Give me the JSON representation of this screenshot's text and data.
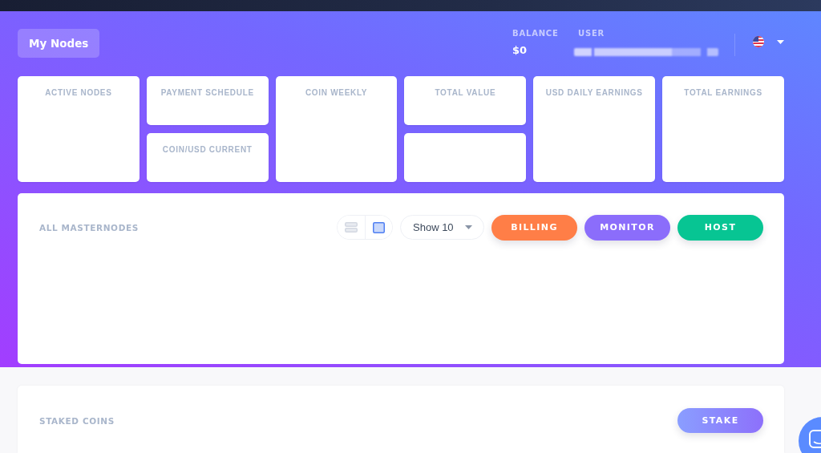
{
  "header": {
    "page_button": "My Nodes",
    "balance": {
      "label": "BALANCE",
      "value": "$0"
    },
    "user": {
      "label": "USER",
      "value_blurred": true
    }
  },
  "stat_columns": [
    {
      "cards": [
        {
          "kind": "titled",
          "title": "ACTIVE NODES"
        }
      ]
    },
    {
      "cards": [
        {
          "kind": "titled",
          "title": "PAYMENT SCHEDULE"
        },
        {
          "kind": "titled",
          "title": "COIN/USD CURRENT"
        }
      ]
    },
    {
      "cards": [
        {
          "kind": "titled",
          "title": "COIN WEEKLY"
        }
      ]
    },
    {
      "cards": [
        {
          "kind": "titled",
          "title": "TOTAL VALUE"
        },
        {
          "kind": "blank"
        }
      ]
    },
    {
      "cards": [
        {
          "kind": "titled",
          "title": "USD DAILY EARNINGS"
        }
      ]
    },
    {
      "cards": [
        {
          "kind": "titled",
          "title": "TOTAL EARNINGS"
        }
      ]
    }
  ],
  "masternodes": {
    "title": "ALL MASTERNODES",
    "view_toggle": [
      {
        "kind": "list",
        "selected": false
      },
      {
        "kind": "grid",
        "selected": true
      }
    ],
    "page_size": {
      "value": "Show 10"
    },
    "buttons": [
      {
        "label": "BILLING",
        "color": "#ff7e47"
      },
      {
        "label": "MONITOR",
        "color": "#8b6dfb"
      },
      {
        "label": "HOST",
        "color": "#07c593"
      }
    ]
  },
  "staked": {
    "title": "STAKED COINS",
    "button": "STAKE"
  }
}
